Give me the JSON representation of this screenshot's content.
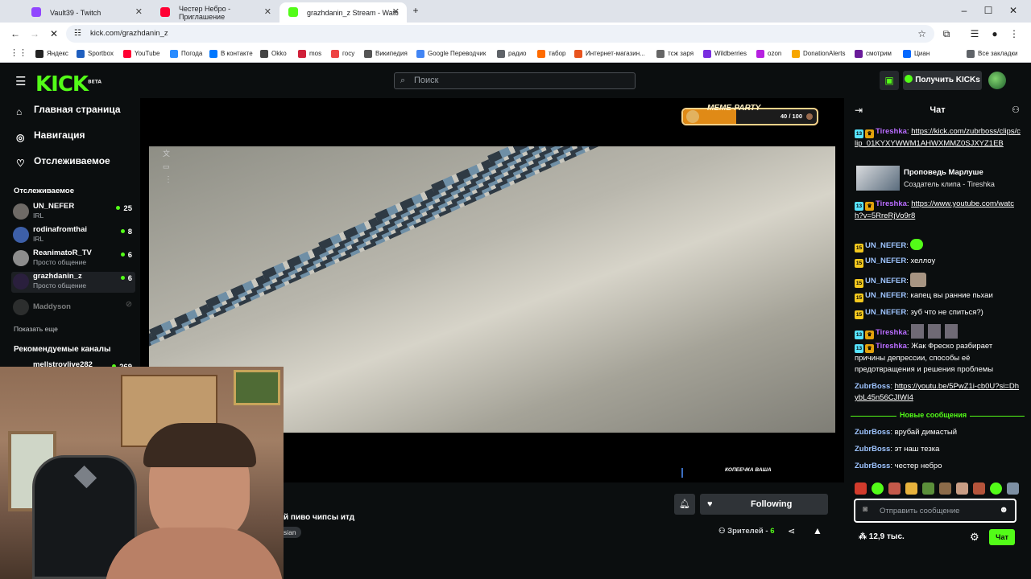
{
  "browser": {
    "tabs": [
      {
        "title": "Vault39 - Twitch",
        "color": "#9146ff"
      },
      {
        "title": "Честер Небро - Приглашение",
        "color": "#ff0033"
      },
      {
        "title": "grazhdanin_z Stream - Watc",
        "color": "#53fc18"
      }
    ],
    "url": "kick.com/grazhdanin_z",
    "bookmarks": [
      {
        "label": "Яндекс",
        "color": "#222"
      },
      {
        "label": "Sportbox",
        "color": "#1f5fbf"
      },
      {
        "label": "YouTube",
        "color": "#ff0033"
      },
      {
        "label": "Погода",
        "color": "#2a8cff"
      },
      {
        "label": "В контакте",
        "color": "#0077ff"
      },
      {
        "label": "Okko",
        "color": "#444"
      },
      {
        "label": "mos",
        "color": "#d0213a"
      },
      {
        "label": "госу",
        "color": "#ee4444"
      },
      {
        "label": "Википедия",
        "color": "#555"
      },
      {
        "label": "Google Переводчик",
        "color": "#4285f4"
      },
      {
        "label": "радио",
        "color": "#5f6368"
      },
      {
        "label": "табор",
        "color": "#ff6b00"
      },
      {
        "label": "Интернет-магазин...",
        "color": "#e8541e"
      },
      {
        "label": "тсж заря",
        "color": "#666"
      },
      {
        "label": "Wildberries",
        "color": "#7a2ee0"
      },
      {
        "label": "ozon",
        "color": "#b620e0"
      },
      {
        "label": "DonationAlerts",
        "color": "#f7a600"
      },
      {
        "label": "смотрим",
        "color": "#6a1b9a"
      },
      {
        "label": "Циан",
        "color": "#0468ff"
      }
    ],
    "all_bookmarks": "Все закладки"
  },
  "kick": {
    "logo": "KICK",
    "logo_badge": "BETA",
    "search_placeholder": "Поиск",
    "get_kicks": "Получить KICKs"
  },
  "sidebar": {
    "nav": [
      "Главная страница",
      "Навигация",
      "Отслеживаемое"
    ],
    "followed_title": "Отслеживаемое",
    "followed": [
      {
        "name": "UN_NEFER",
        "category": "IRL",
        "viewers": "25"
      },
      {
        "name": "rodinafromthai",
        "category": "IRL",
        "viewers": "8"
      },
      {
        "name": "ReanimatoR_TV",
        "category": "Просто общение",
        "viewers": "6"
      },
      {
        "name": "grazhdanin_z",
        "category": "Просто общение",
        "viewers": "6"
      },
      {
        "name": "Maddyson",
        "category": "",
        "viewers": ""
      }
    ],
    "show_more": "Показать еще",
    "recommended_title": "Рекомендуемые каналы",
    "recommended_first": "mellstroylive282",
    "recommended_viewers": "269"
  },
  "player": {
    "meme_party": "MEME-PARTY",
    "meme_progress_text": "40 / 100",
    "meme_progress": 0.4,
    "caption": "КОПЕЕЧКА ВАША"
  },
  "stream": {
    "title_fragment": "й пиво чипсы итд",
    "tag_fragment": "sian",
    "following": "Following",
    "viewers_label": "Зрителей",
    "viewers_count": "6"
  },
  "chat": {
    "header": "Чат",
    "clip_title": "Проповедь Марлуше",
    "clip_creator": "Создатель клипа - Tireshka",
    "new_messages": "Новые сообщения",
    "input_placeholder": "Отправить сообщение",
    "kicks_balance": "12,9 тыс.",
    "send_button": "Чат",
    "messages": [
      {
        "user": "Tireshka",
        "text": "https://kick.com/zubrboss/clips/clip_01KYXYWWM1AHWXMMZ0SJXYZ1EB"
      },
      {
        "user": "Tireshka",
        "text": "https://www.youtube.com/watch?v=5RreRjVo9r8"
      },
      {
        "user": "UN_NEFER",
        "text": ""
      },
      {
        "user": "UN_NEFER",
        "text": "хеллоу"
      },
      {
        "user": "UN_NEFER",
        "text": ""
      },
      {
        "user": "UN_NEFER",
        "text": "капец вы ранние пьхаи"
      },
      {
        "user": "UN_NEFER",
        "text": "зуб что не спиться?)"
      },
      {
        "user": "Tireshka",
        "text": ""
      },
      {
        "user": "Tireshka",
        "text": "Жак Фреско разбирает причины депрессии, способы её предотвращения и решения проблемы"
      },
      {
        "user": "ZubrBoss",
        "text": "https://youtu.be/5PwZ1i-cb0U?si=DhybL45n56CJIWI4"
      },
      {
        "user": "ZubrBoss",
        "text": "врубай димастый"
      },
      {
        "user": "ZubrBoss",
        "text": "эт наш тезка"
      },
      {
        "user": "ZubrBoss",
        "text": "честер небро"
      }
    ]
  }
}
